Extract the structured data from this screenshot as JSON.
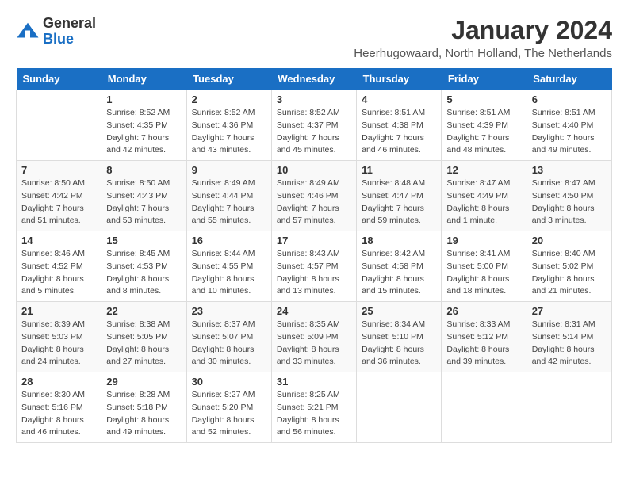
{
  "header": {
    "logo_general": "General",
    "logo_blue": "Blue",
    "month_title": "January 2024",
    "location": "Heerhugowaard, North Holland, The Netherlands"
  },
  "weekdays": [
    "Sunday",
    "Monday",
    "Tuesday",
    "Wednesday",
    "Thursday",
    "Friday",
    "Saturday"
  ],
  "weeks": [
    [
      {
        "day": "",
        "sunrise": "",
        "sunset": "",
        "daylight": ""
      },
      {
        "day": "1",
        "sunrise": "Sunrise: 8:52 AM",
        "sunset": "Sunset: 4:35 PM",
        "daylight": "Daylight: 7 hours and 42 minutes."
      },
      {
        "day": "2",
        "sunrise": "Sunrise: 8:52 AM",
        "sunset": "Sunset: 4:36 PM",
        "daylight": "Daylight: 7 hours and 43 minutes."
      },
      {
        "day": "3",
        "sunrise": "Sunrise: 8:52 AM",
        "sunset": "Sunset: 4:37 PM",
        "daylight": "Daylight: 7 hours and 45 minutes."
      },
      {
        "day": "4",
        "sunrise": "Sunrise: 8:51 AM",
        "sunset": "Sunset: 4:38 PM",
        "daylight": "Daylight: 7 hours and 46 minutes."
      },
      {
        "day": "5",
        "sunrise": "Sunrise: 8:51 AM",
        "sunset": "Sunset: 4:39 PM",
        "daylight": "Daylight: 7 hours and 48 minutes."
      },
      {
        "day": "6",
        "sunrise": "Sunrise: 8:51 AM",
        "sunset": "Sunset: 4:40 PM",
        "daylight": "Daylight: 7 hours and 49 minutes."
      }
    ],
    [
      {
        "day": "7",
        "sunrise": "Sunrise: 8:50 AM",
        "sunset": "Sunset: 4:42 PM",
        "daylight": "Daylight: 7 hours and 51 minutes."
      },
      {
        "day": "8",
        "sunrise": "Sunrise: 8:50 AM",
        "sunset": "Sunset: 4:43 PM",
        "daylight": "Daylight: 7 hours and 53 minutes."
      },
      {
        "day": "9",
        "sunrise": "Sunrise: 8:49 AM",
        "sunset": "Sunset: 4:44 PM",
        "daylight": "Daylight: 7 hours and 55 minutes."
      },
      {
        "day": "10",
        "sunrise": "Sunrise: 8:49 AM",
        "sunset": "Sunset: 4:46 PM",
        "daylight": "Daylight: 7 hours and 57 minutes."
      },
      {
        "day": "11",
        "sunrise": "Sunrise: 8:48 AM",
        "sunset": "Sunset: 4:47 PM",
        "daylight": "Daylight: 7 hours and 59 minutes."
      },
      {
        "day": "12",
        "sunrise": "Sunrise: 8:47 AM",
        "sunset": "Sunset: 4:49 PM",
        "daylight": "Daylight: 8 hours and 1 minute."
      },
      {
        "day": "13",
        "sunrise": "Sunrise: 8:47 AM",
        "sunset": "Sunset: 4:50 PM",
        "daylight": "Daylight: 8 hours and 3 minutes."
      }
    ],
    [
      {
        "day": "14",
        "sunrise": "Sunrise: 8:46 AM",
        "sunset": "Sunset: 4:52 PM",
        "daylight": "Daylight: 8 hours and 5 minutes."
      },
      {
        "day": "15",
        "sunrise": "Sunrise: 8:45 AM",
        "sunset": "Sunset: 4:53 PM",
        "daylight": "Daylight: 8 hours and 8 minutes."
      },
      {
        "day": "16",
        "sunrise": "Sunrise: 8:44 AM",
        "sunset": "Sunset: 4:55 PM",
        "daylight": "Daylight: 8 hours and 10 minutes."
      },
      {
        "day": "17",
        "sunrise": "Sunrise: 8:43 AM",
        "sunset": "Sunset: 4:57 PM",
        "daylight": "Daylight: 8 hours and 13 minutes."
      },
      {
        "day": "18",
        "sunrise": "Sunrise: 8:42 AM",
        "sunset": "Sunset: 4:58 PM",
        "daylight": "Daylight: 8 hours and 15 minutes."
      },
      {
        "day": "19",
        "sunrise": "Sunrise: 8:41 AM",
        "sunset": "Sunset: 5:00 PM",
        "daylight": "Daylight: 8 hours and 18 minutes."
      },
      {
        "day": "20",
        "sunrise": "Sunrise: 8:40 AM",
        "sunset": "Sunset: 5:02 PM",
        "daylight": "Daylight: 8 hours and 21 minutes."
      }
    ],
    [
      {
        "day": "21",
        "sunrise": "Sunrise: 8:39 AM",
        "sunset": "Sunset: 5:03 PM",
        "daylight": "Daylight: 8 hours and 24 minutes."
      },
      {
        "day": "22",
        "sunrise": "Sunrise: 8:38 AM",
        "sunset": "Sunset: 5:05 PM",
        "daylight": "Daylight: 8 hours and 27 minutes."
      },
      {
        "day": "23",
        "sunrise": "Sunrise: 8:37 AM",
        "sunset": "Sunset: 5:07 PM",
        "daylight": "Daylight: 8 hours and 30 minutes."
      },
      {
        "day": "24",
        "sunrise": "Sunrise: 8:35 AM",
        "sunset": "Sunset: 5:09 PM",
        "daylight": "Daylight: 8 hours and 33 minutes."
      },
      {
        "day": "25",
        "sunrise": "Sunrise: 8:34 AM",
        "sunset": "Sunset: 5:10 PM",
        "daylight": "Daylight: 8 hours and 36 minutes."
      },
      {
        "day": "26",
        "sunrise": "Sunrise: 8:33 AM",
        "sunset": "Sunset: 5:12 PM",
        "daylight": "Daylight: 8 hours and 39 minutes."
      },
      {
        "day": "27",
        "sunrise": "Sunrise: 8:31 AM",
        "sunset": "Sunset: 5:14 PM",
        "daylight": "Daylight: 8 hours and 42 minutes."
      }
    ],
    [
      {
        "day": "28",
        "sunrise": "Sunrise: 8:30 AM",
        "sunset": "Sunset: 5:16 PM",
        "daylight": "Daylight: 8 hours and 46 minutes."
      },
      {
        "day": "29",
        "sunrise": "Sunrise: 8:28 AM",
        "sunset": "Sunset: 5:18 PM",
        "daylight": "Daylight: 8 hours and 49 minutes."
      },
      {
        "day": "30",
        "sunrise": "Sunrise: 8:27 AM",
        "sunset": "Sunset: 5:20 PM",
        "daylight": "Daylight: 8 hours and 52 minutes."
      },
      {
        "day": "31",
        "sunrise": "Sunrise: 8:25 AM",
        "sunset": "Sunset: 5:21 PM",
        "daylight": "Daylight: 8 hours and 56 minutes."
      },
      {
        "day": "",
        "sunrise": "",
        "sunset": "",
        "daylight": ""
      },
      {
        "day": "",
        "sunrise": "",
        "sunset": "",
        "daylight": ""
      },
      {
        "day": "",
        "sunrise": "",
        "sunset": "",
        "daylight": ""
      }
    ]
  ]
}
